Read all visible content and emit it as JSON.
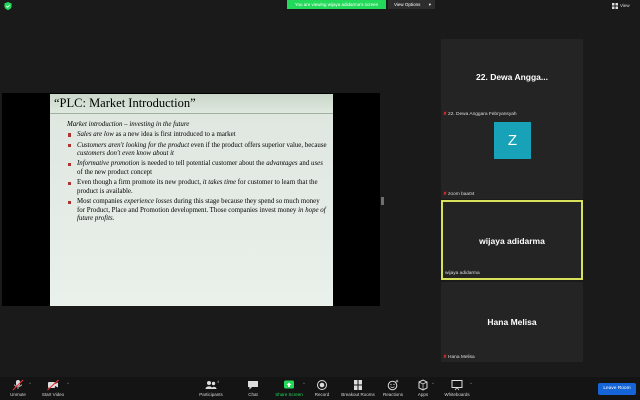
{
  "banner": {
    "text": "You are viewing wijaya adidarma's screen"
  },
  "view_options": {
    "label": "View Options",
    "chevron": "chevron-down-icon"
  },
  "top_right": {
    "view_label": "View",
    "icon": "grid-icon"
  },
  "slide": {
    "title": "“PLC: Market Introduction”",
    "heading": "Market introduction – investing in the future",
    "bullets": [
      {
        "parts": [
          {
            "t": "Sales are low",
            "i": true
          },
          {
            "t": " as a new idea is first introduced to a market",
            "i": false
          }
        ]
      },
      {
        "parts": [
          {
            "t": "Customers aren't looking for the product",
            "i": true
          },
          {
            "t": " even if the product offers superior value, because ",
            "i": false
          },
          {
            "t": "customers don't even know about it",
            "i": true
          }
        ]
      },
      {
        "parts": [
          {
            "t": "Informative promotion",
            "i": true
          },
          {
            "t": " is needed to tell potential customer about the ",
            "i": false
          },
          {
            "t": "advantages",
            "i": true
          },
          {
            "t": " and ",
            "i": false
          },
          {
            "t": "uses",
            "i": true
          },
          {
            "t": " of the new product concept",
            "i": false
          }
        ]
      },
      {
        "parts": [
          {
            "t": "Even though a firm promote its new product, ",
            "i": false
          },
          {
            "t": "it takes time",
            "i": true
          },
          {
            "t": " for customer to learn that the product is available.",
            "i": false
          }
        ]
      },
      {
        "parts": [
          {
            "t": "Most companies ",
            "i": false
          },
          {
            "t": "experience losses",
            "i": true
          },
          {
            "t": " during this stage because they spend so much money for Product, Place and Promotion development. Those companies invest money ",
            "i": false
          },
          {
            "t": "in hope of future profits.",
            "i": true
          }
        ]
      }
    ]
  },
  "participants": [
    {
      "display": "22. Dewa Angga...",
      "label": "22. Dewa Anggara Febryansyah",
      "muted": true
    },
    {
      "avatar": "Z",
      "label": "zoom baa04",
      "muted": true
    },
    {
      "display": "wijaya adidarma",
      "label": "wijaya adidarma",
      "muted": false,
      "active": true
    },
    {
      "display": "Hana Melisa",
      "label": "Hana Melisa",
      "muted": true
    }
  ],
  "toolbar": {
    "unmute": "Unmute",
    "start_video": "Start Video",
    "participants": "Participants",
    "participant_count": "4",
    "chat": "Chat",
    "share_screen": "Share Screen",
    "record": "Record",
    "breakout_rooms": "Breakout Rooms",
    "reactions": "Reactions",
    "apps": "Apps",
    "whiteboards": "Whiteboards",
    "leave": "Leave Room"
  },
  "colors": {
    "accent_green": "#23d959",
    "active_border": "#d8e15a",
    "leave_blue": "#1565d8",
    "avatar_bg": "#17a2b8"
  }
}
